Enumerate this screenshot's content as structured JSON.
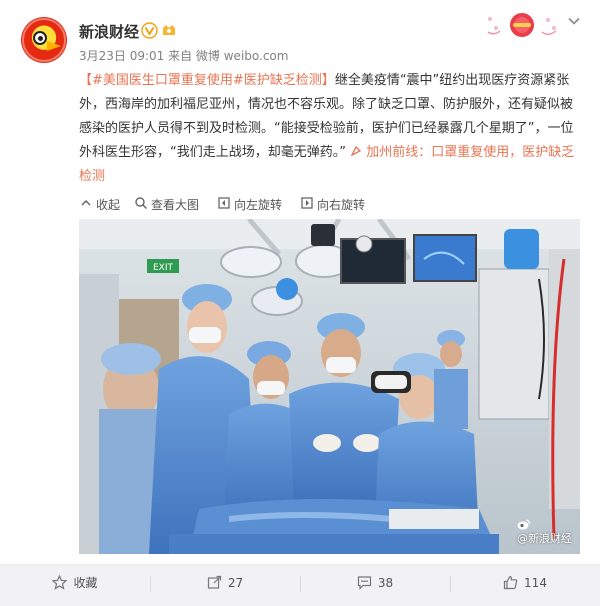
{
  "header": {
    "username": "新浪财经",
    "meta": "3月23日 09:01 来自 微博 weibo.com"
  },
  "post": {
    "topic_1": "【#美国医生口罩重复使用#",
    "topic_2": "医护缺乏检测】",
    "body": "继全美疫情“震中”纽约出现医疗资源紧张外，西海岸的加利福尼亚州，情况也不容乐观。除了缺乏口罩、防护服外，还有疑似被感染的医护人员得不到及时检测。“能接受检验前，医护们已经暴露几个星期了”，一位外科医生形容，“我们走上战场，却毫无弹药。”",
    "link_prefix": "加州前线：",
    "link_text": "口罩重复使用，医护缺乏检测"
  },
  "image_actions": {
    "collapse": "收起",
    "view_large": "查看大图",
    "rotate_left": "向左旋转",
    "rotate_right": "向右旋转"
  },
  "image": {
    "watermark": "@新浪财经",
    "exit_sign": "EXIT"
  },
  "footer": {
    "favorite": "收藏",
    "repost_count": "27",
    "comment_count": "38",
    "like_count": "114"
  },
  "colors": {
    "accent": "#eb7350",
    "link": "#eb7350",
    "vip_badge": "#f1a20f"
  }
}
